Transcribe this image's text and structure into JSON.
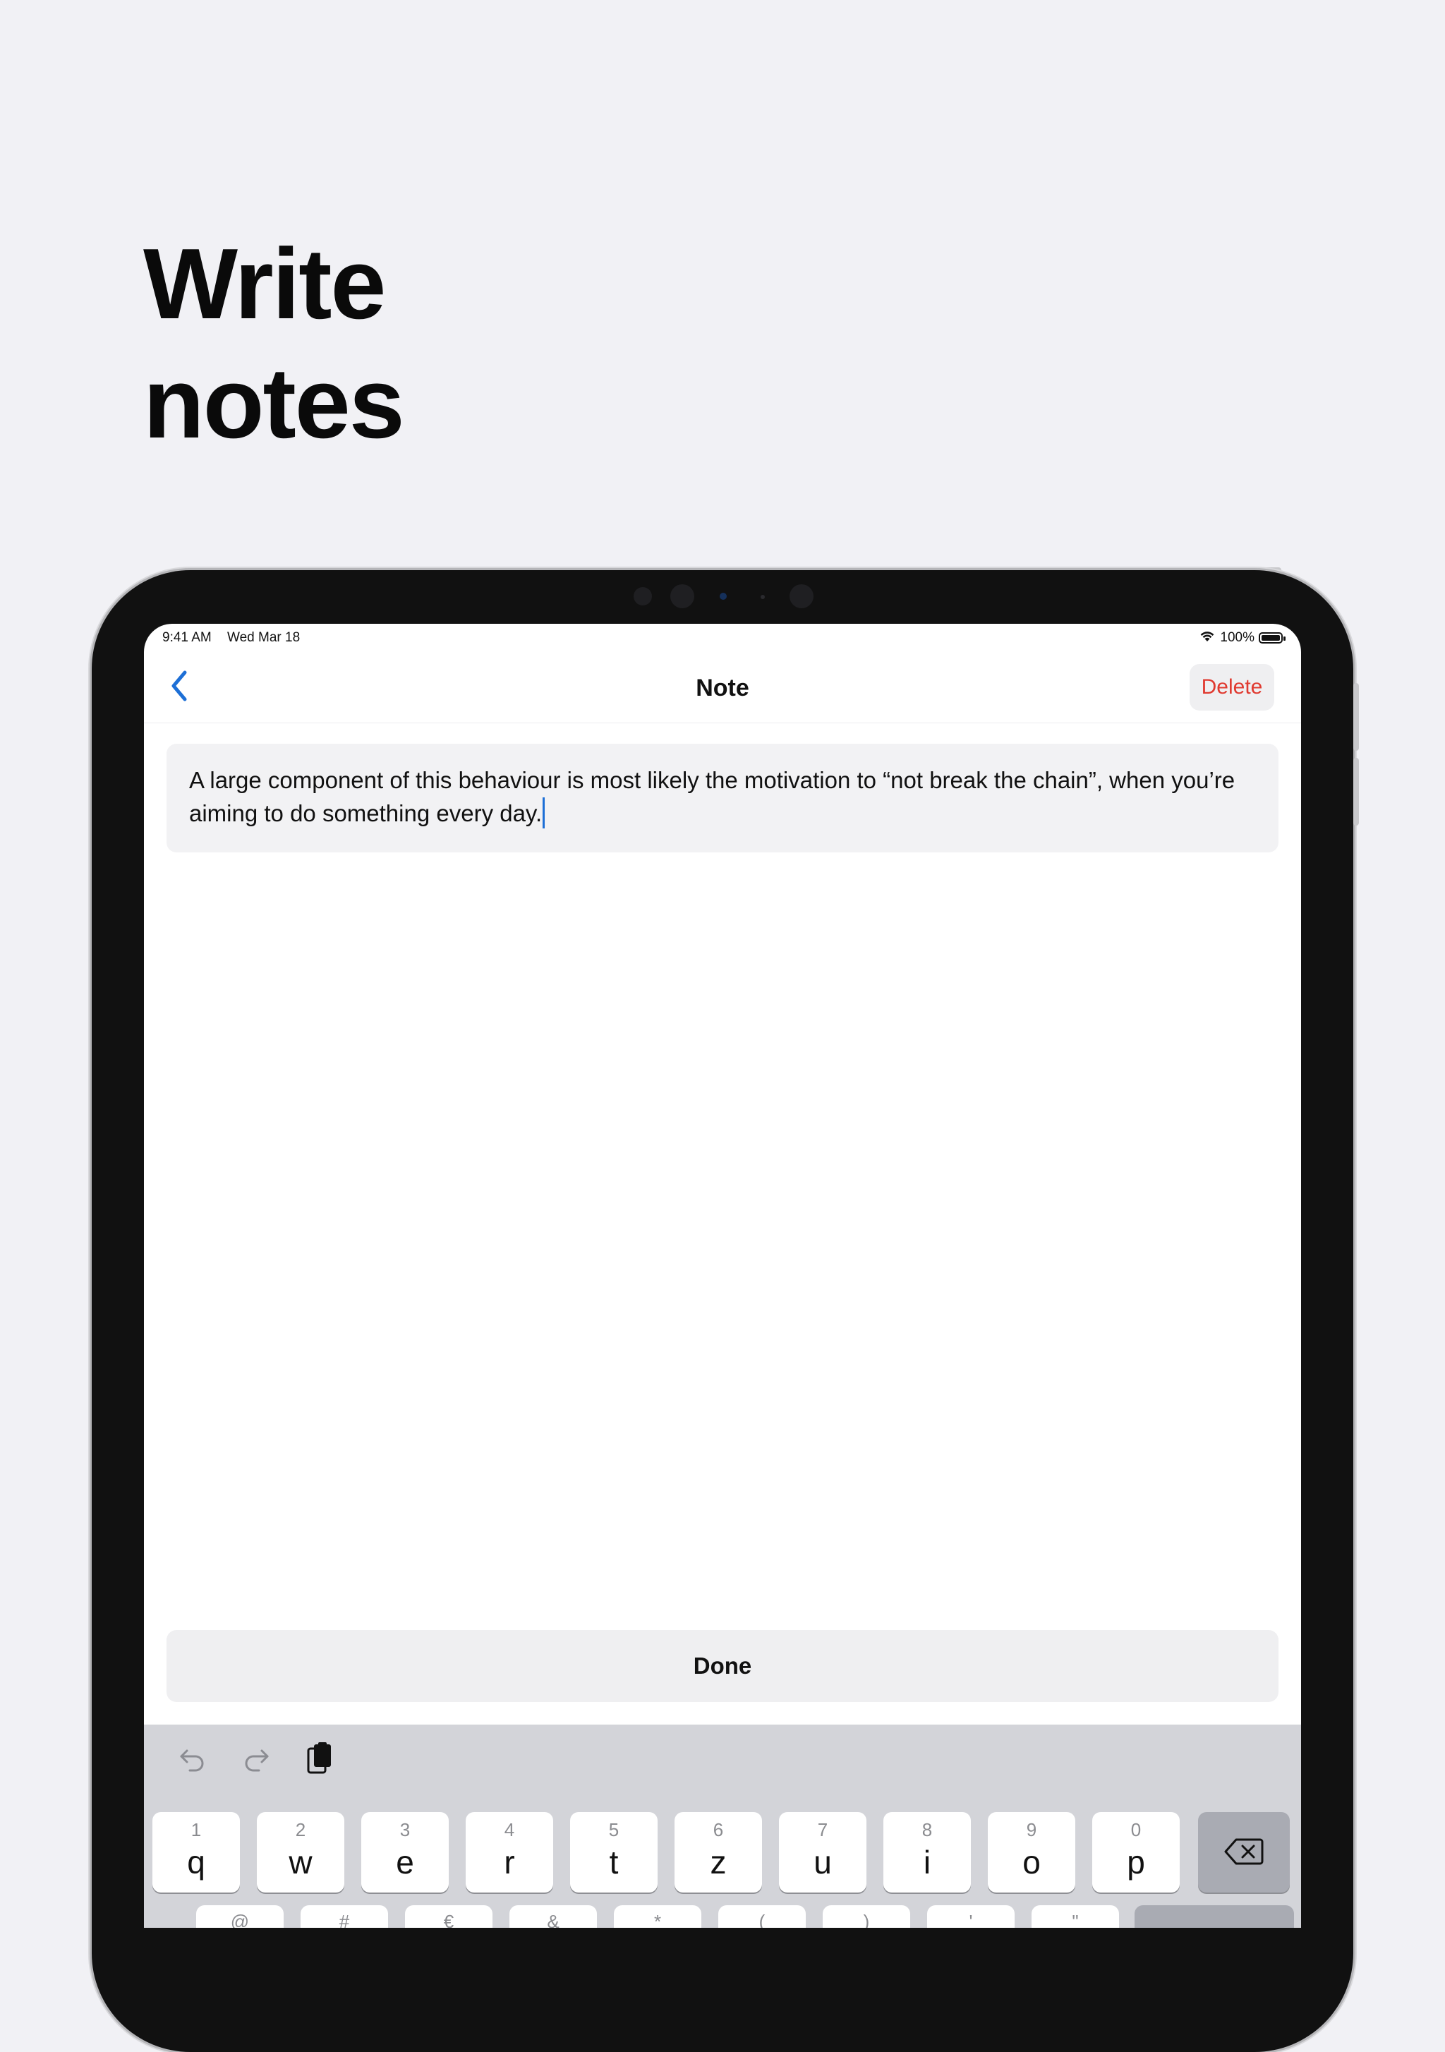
{
  "headline": {
    "line1": "Write",
    "line2": "notes"
  },
  "status_bar": {
    "time": "9:41 AM",
    "date": "Wed Mar 18",
    "battery": "100%"
  },
  "navbar": {
    "title": "Note",
    "delete_label": "Delete"
  },
  "note": {
    "text": "A large component of this behaviour is most likely the motivation to “not break the chain”, when you’re aiming to do something every day."
  },
  "done_label": "Done",
  "keyboard": {
    "row1": [
      {
        "num": "1",
        "ch": "q"
      },
      {
        "num": "2",
        "ch": "w"
      },
      {
        "num": "3",
        "ch": "e"
      },
      {
        "num": "4",
        "ch": "r"
      },
      {
        "num": "5",
        "ch": "t"
      },
      {
        "num": "6",
        "ch": "z"
      },
      {
        "num": "7",
        "ch": "u"
      },
      {
        "num": "8",
        "ch": "i"
      },
      {
        "num": "9",
        "ch": "o"
      },
      {
        "num": "0",
        "ch": "p"
      }
    ],
    "row2_nums": [
      "@",
      "#",
      "€",
      "&",
      "*",
      "(",
      ")",
      "'",
      "\""
    ]
  },
  "colors": {
    "accent": "#1d6fd6",
    "destructive": "#e03a30",
    "background": "#f1f1f5"
  },
  "icons": [
    "chevron-left-icon",
    "wifi-icon",
    "battery-icon",
    "undo-icon",
    "redo-icon",
    "paste-icon",
    "backspace-icon"
  ]
}
